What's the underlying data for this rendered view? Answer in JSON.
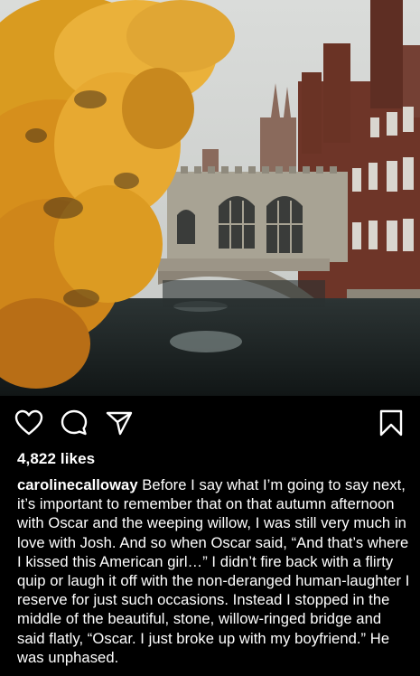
{
  "post": {
    "image": {
      "subject": "autumn-tree-stone-bridge-river-brick-college",
      "colors": {
        "foliage": "#e3a228",
        "sky": "#d4d6d4",
        "brick": "#7a3b2c",
        "stone": "#a39e91",
        "water": "#1c2222"
      }
    },
    "actions": {
      "like_icon": "heart-icon",
      "comment_icon": "comment-icon",
      "share_icon": "share-icon",
      "save_icon": "bookmark-icon"
    },
    "likes_text": "4,822 likes",
    "caption": {
      "username": "carolinecalloway",
      "text": "Before I say what I’m going to say next, it’s important to remember that on that autumn afternoon with Oscar and the weeping willow, I was still very much in love with Josh. And so when Oscar said, “And that’s where I kissed this American girl…” I didn’t fire back with a flirty quip or laugh it off with the non-deranged human-laughter I reserve for just such occasions. Instead I stopped in the middle of the beautiful, stone, willow-ringed bridge and said flatly, “Oscar. I just broke up with my boyfriend.” He was unphased."
    }
  }
}
